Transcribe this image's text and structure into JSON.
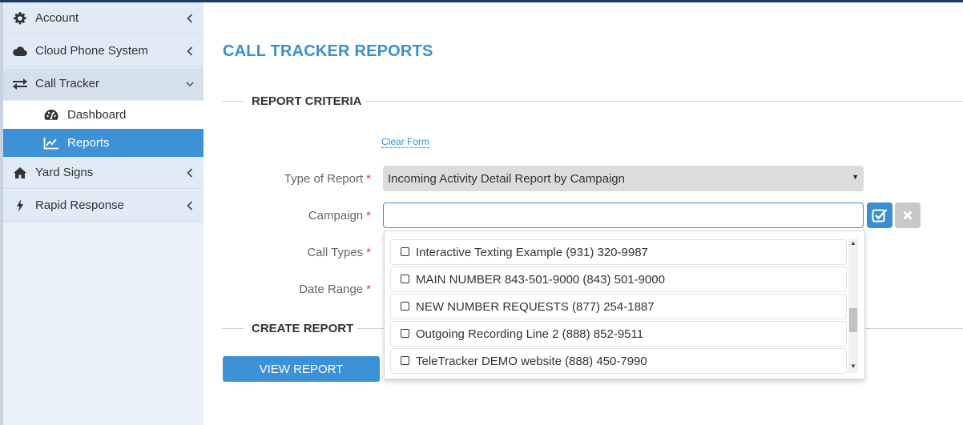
{
  "sidebar": {
    "items": [
      {
        "label": "Account",
        "icon": "gear-icon"
      },
      {
        "label": "Cloud Phone System",
        "icon": "cloud-icon"
      },
      {
        "label": "Call Tracker",
        "icon": "exchange-arrows-icon"
      },
      {
        "label": "Yard Signs",
        "icon": "home-icon"
      },
      {
        "label": "Rapid Response",
        "icon": "bolt-icon"
      }
    ],
    "subitems": [
      {
        "label": "Dashboard",
        "icon": "dashboard-gauge-icon"
      },
      {
        "label": "Reports",
        "icon": "line-chart-icon"
      }
    ]
  },
  "main": {
    "title": "CALL TRACKER REPORTS",
    "criteria_title": "REPORT CRITERIA",
    "create_title": "CREATE REPORT",
    "clear_link": "Clear Form",
    "labels": {
      "type_of_report": "Type of Report",
      "campaign": "Campaign",
      "call_types": "Call Types",
      "date_range": "Date Range",
      "required": "*"
    },
    "type_of_report_value": "Incoming Activity Detail Report by Campaign",
    "campaign_value": "",
    "view_button": "VIEW REPORT",
    "dropdown_items": [
      "Interactive Texting Example (931) 320-9987",
      "MAIN NUMBER 843-501-9000 (843) 501-9000",
      "NEW NUMBER REQUESTS (877) 254-1887",
      "Outgoing Recording Line 2 (888) 852-9511",
      "TeleTracker DEMO website (888) 450-7990"
    ]
  },
  "colors": {
    "accent": "#3d91d6",
    "title": "#3b8fd0",
    "required": "#e03a3a",
    "sidebar_bg": "#e1ebf6"
  }
}
